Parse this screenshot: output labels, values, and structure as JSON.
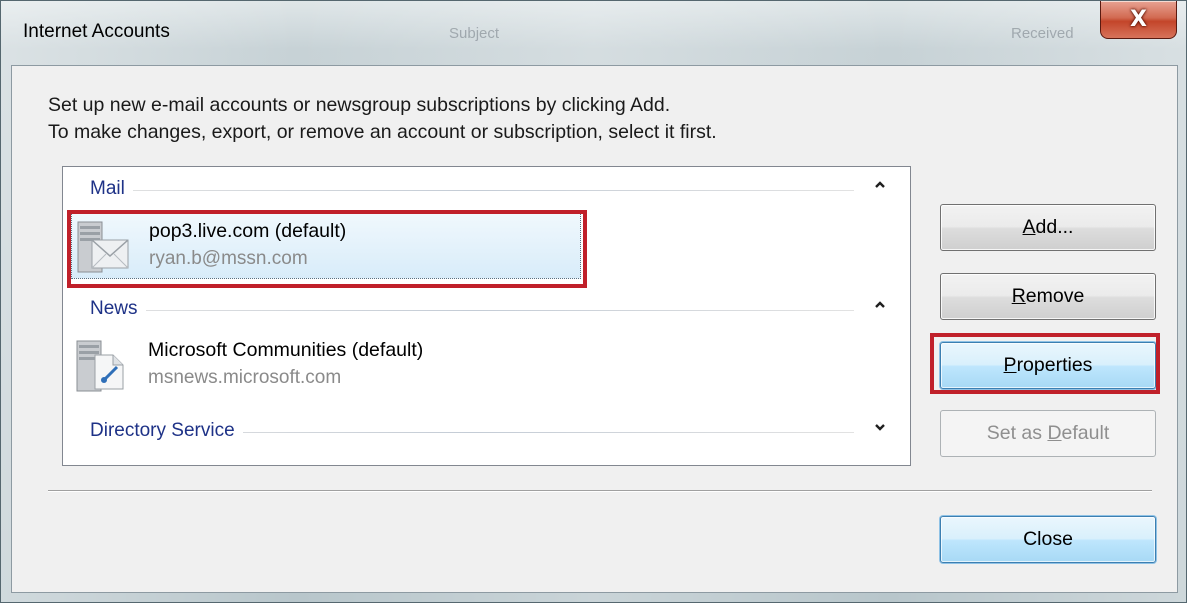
{
  "window": {
    "title": "Internet Accounts",
    "background_subject": "Subject",
    "background_received": "Received",
    "close_glyph": "X"
  },
  "instructions": {
    "line1": "Set up new e-mail accounts or newsgroup subscriptions by clicking Add.",
    "line2": "To make changes, export, or remove an account or subscription, select it first."
  },
  "groups": {
    "mail": {
      "label": "Mail",
      "chevron": "up",
      "item": {
        "title": "pop3.live.com (default)",
        "subtitle": "ryan.b@mssn.com",
        "icon": "mail-server-icon",
        "selected": true
      }
    },
    "news": {
      "label": "News",
      "chevron": "up",
      "item": {
        "title": "Microsoft Communities (default)",
        "subtitle": "msnews.microsoft.com",
        "icon": "news-server-icon",
        "selected": false
      }
    },
    "directory": {
      "label": "Directory Service",
      "chevron": "down"
    }
  },
  "buttons": {
    "add": {
      "label_pre": "",
      "label_u": "A",
      "label_post": "dd..."
    },
    "remove": {
      "label_pre": "",
      "label_u": "R",
      "label_post": "emove"
    },
    "properties": {
      "label_pre": "",
      "label_u": "P",
      "label_post": "roperties"
    },
    "set_default": {
      "label_pre": "Set as ",
      "label_u": "D",
      "label_post": "efault"
    },
    "close": {
      "label": "Close"
    }
  },
  "colors": {
    "highlight": "#c0202a",
    "group_label": "#1e3287",
    "accent": "#3c7fb1"
  }
}
